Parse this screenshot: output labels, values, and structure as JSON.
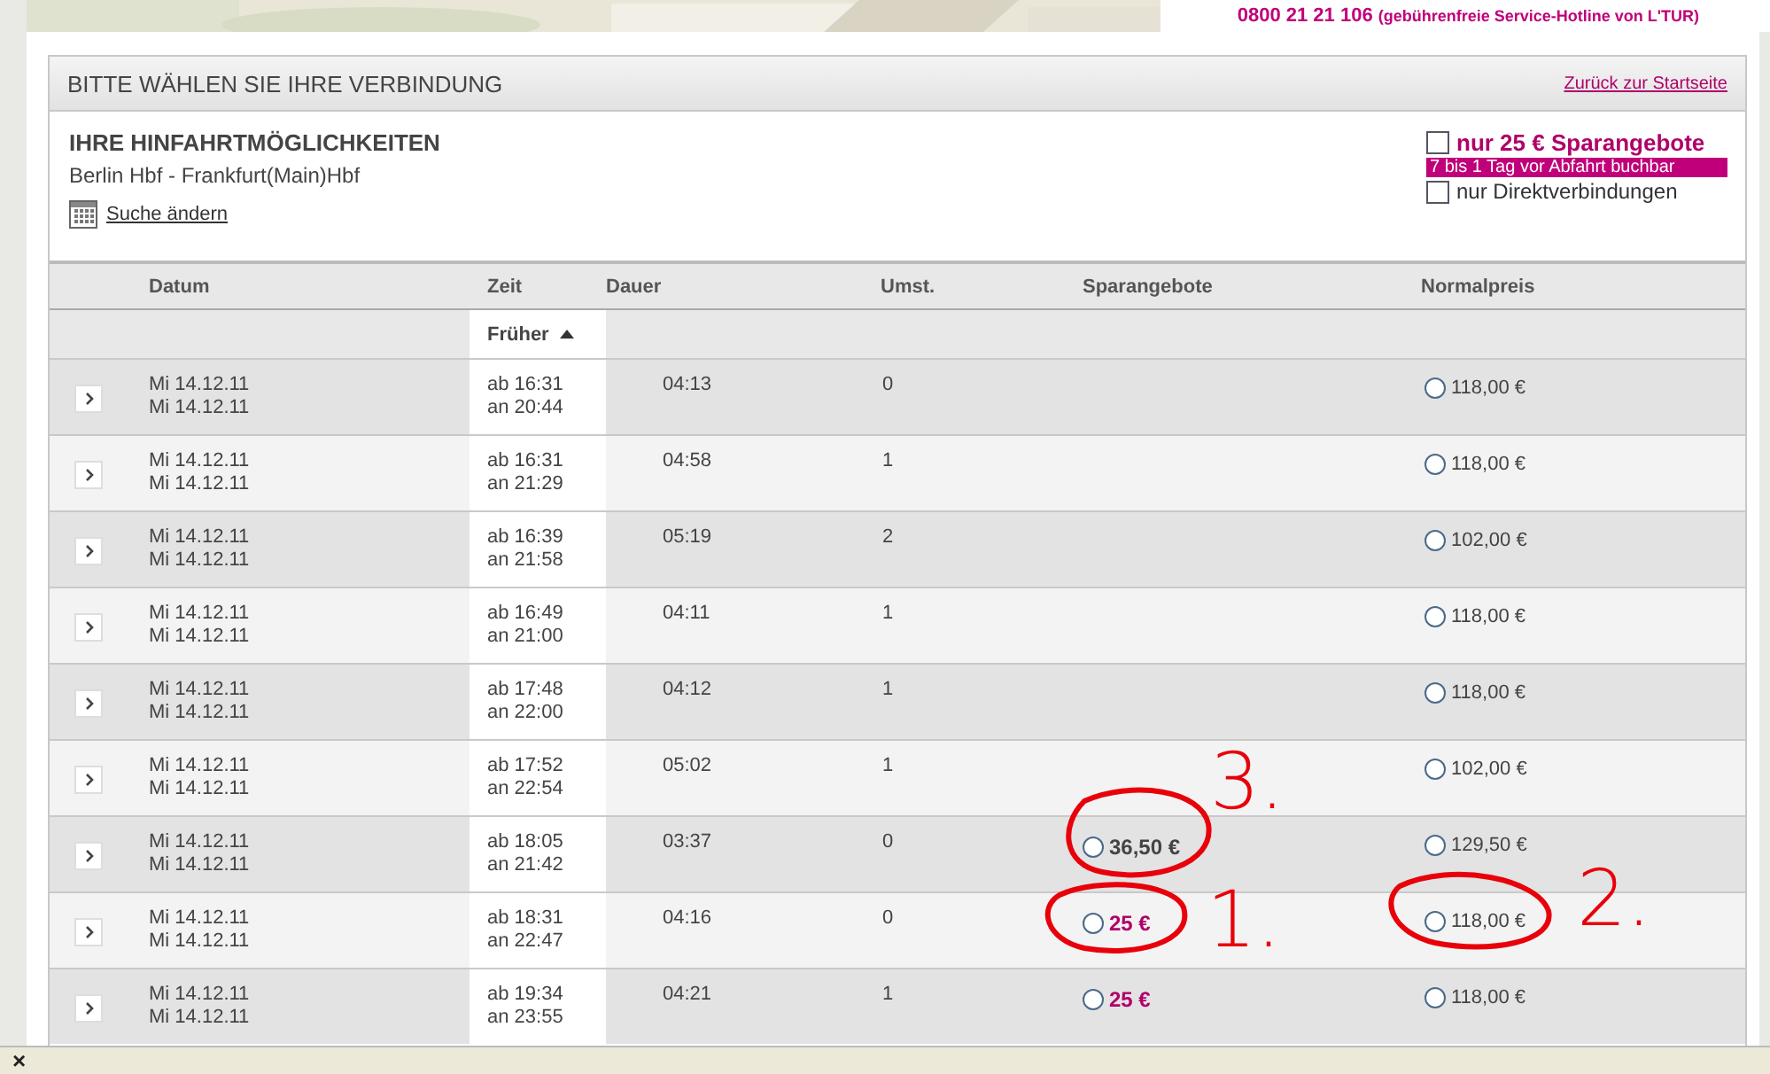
{
  "banner": {
    "hotline": "0800 21 21 106",
    "hotline_note": "(gebührenfreie Service-Hotline von L'TUR)"
  },
  "panel": {
    "title": "BITTE WÄHLEN SIE IHRE VERBINDUNG",
    "back_link": "Zurück zur Startseite"
  },
  "outbound": {
    "heading": "IHRE HINFAHRTMÖGLICHKEITEN",
    "route": "Berlin Hbf - Frankfurt(Main)Hbf",
    "change_search": "Suche ändern"
  },
  "filters": [
    {
      "kind": "offer",
      "label": "nur 25 € Sparangebote",
      "checked": false,
      "note": "7 bis 1 Tag vor Abfahrt buchbar"
    },
    {
      "kind": "plain",
      "label": "nur Direktverbindungen",
      "checked": false
    }
  ],
  "table": {
    "columns": [
      "Datum",
      "Zeit",
      "Dauer",
      "Umst.",
      "Sparangebote",
      "Normalpreis"
    ],
    "earlier": "Früher",
    "rows": [
      {
        "dates": [
          "Mi 14.12.11",
          "Mi 14.12.11"
        ],
        "times": [
          "ab 16:31",
          "an 20:44"
        ],
        "duration": "04:13",
        "changes": "0",
        "normal": {
          "price": "118,00 €",
          "selected": false
        }
      },
      {
        "dates": [
          "Mi 14.12.11",
          "Mi 14.12.11"
        ],
        "times": [
          "ab 16:31",
          "an 21:29"
        ],
        "duration": "04:58",
        "changes": "1",
        "normal": {
          "price": "118,00 €",
          "selected": false
        }
      },
      {
        "dates": [
          "Mi 14.12.11",
          "Mi 14.12.11"
        ],
        "times": [
          "ab 16:39",
          "an 21:58"
        ],
        "duration": "05:19",
        "changes": "2",
        "normal": {
          "price": "102,00 €",
          "selected": false
        }
      },
      {
        "dates": [
          "Mi 14.12.11",
          "Mi 14.12.11"
        ],
        "times": [
          "ab 16:49",
          "an 21:00"
        ],
        "duration": "04:11",
        "changes": "1",
        "normal": {
          "price": "118,00 €",
          "selected": false
        }
      },
      {
        "dates": [
          "Mi 14.12.11",
          "Mi 14.12.11"
        ],
        "times": [
          "ab 17:48",
          "an 22:00"
        ],
        "duration": "04:12",
        "changes": "1",
        "normal": {
          "price": "118,00 €",
          "selected": false
        }
      },
      {
        "dates": [
          "Mi 14.12.11",
          "Mi 14.12.11"
        ],
        "times": [
          "ab 17:52",
          "an 22:54"
        ],
        "duration": "05:02",
        "changes": "1",
        "normal": {
          "price": "102,00 €",
          "selected": false
        }
      },
      {
        "dates": [
          "Mi 14.12.11",
          "Mi 14.12.11"
        ],
        "times": [
          "ab 18:05",
          "an 21:42"
        ],
        "duration": "03:37",
        "changes": "0",
        "saver": {
          "kind": "regular",
          "price": "36,50 €",
          "selected": false
        },
        "normal": {
          "price": "129,50 €",
          "selected": false
        }
      },
      {
        "dates": [
          "Mi 14.12.11",
          "Mi 14.12.11"
        ],
        "times": [
          "ab 18:31",
          "an 22:47"
        ],
        "duration": "04:16",
        "changes": "0",
        "saver": {
          "kind": "offer",
          "price": "25 €",
          "selected": false
        },
        "normal": {
          "price": "118,00 €",
          "selected": false
        }
      },
      {
        "dates": [
          "Mi 14.12.11",
          "Mi 14.12.11"
        ],
        "times": [
          "ab 19:34",
          "an 23:55"
        ],
        "duration": "04:21",
        "changes": "1",
        "saver": {
          "kind": "offer",
          "price": "25 €",
          "selected": false
        },
        "normal": {
          "price": "118,00 €",
          "selected": false
        }
      }
    ]
  },
  "annotations": [
    {
      "label": "3."
    },
    {
      "label": "1."
    },
    {
      "label": "2."
    }
  ],
  "status_bar": {
    "close": "×"
  }
}
